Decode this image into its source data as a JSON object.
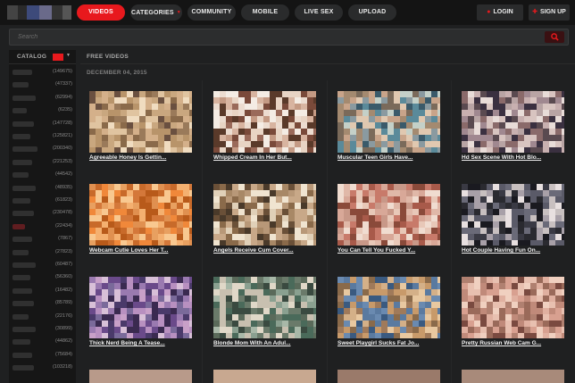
{
  "nav": {
    "items": [
      {
        "label": "VIDEOS",
        "active": true
      },
      {
        "label": "CATEGORIES",
        "caret": true
      },
      {
        "label": "COMMUNITY"
      },
      {
        "label": "MOBILE"
      },
      {
        "label": "LIVE SEX"
      },
      {
        "label": "UPLOAD"
      }
    ],
    "login": "LOGIN",
    "signup": "SIGN UP"
  },
  "search": {
    "placeholder": "Search"
  },
  "sidebar": {
    "header": "CATALOG",
    "counts": [
      "(149675)",
      "(47337)",
      "(62994)",
      "(6235)",
      "(147728)",
      "(125821)",
      "(200340)",
      "(221253)",
      "(44542)",
      "(48935)",
      "(61823)",
      "(230478)",
      "(22434)",
      "(7867)",
      "(27823)",
      "(60487)",
      "(56360)",
      "(16482)",
      "(85789)",
      "(22176)",
      "(30899)",
      "(44862)",
      "(75684)",
      "(103218)"
    ]
  },
  "main": {
    "header": "FREE VIDEOS",
    "date": "DECEMBER 04, 2015",
    "videos": [
      "Agreeable Honey Is Gettin...",
      "Whipped Cream In Her But...",
      "Muscular Teen Girls Have...",
      "Hd Sex Scene With Hot Blo...",
      "Webcam Cutie Loves Her T...",
      "Angels Receive Cum Cover...",
      "You Can Tell You Fucked Y...",
      "Hot Couple Having Fun On...",
      "Thick Nerd Being A Tease...",
      "Blonde Mom With An Adul...",
      "Sweet Playgirl Sucks Fat Jo...",
      "Pretty Russian Web Cam G..."
    ]
  },
  "colors": {
    "accent": "#e8191d",
    "background": "#1f2021",
    "topbar": "#141414"
  },
  "icons": {
    "search": "search-icon",
    "login": "login-icon",
    "signup": "plus-icon"
  }
}
